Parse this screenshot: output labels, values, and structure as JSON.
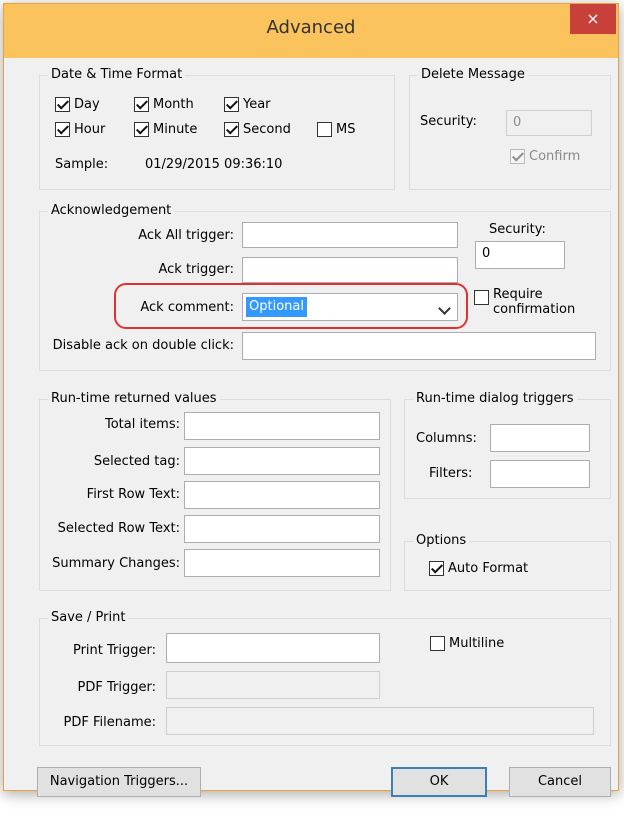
{
  "window": {
    "title": "Advanced",
    "close_glyph": "×"
  },
  "datetime": {
    "legend": "Date & Time Format",
    "day": "Day",
    "month": "Month",
    "year": "Year",
    "hour": "Hour",
    "minute": "Minute",
    "second": "Second",
    "ms": "MS",
    "sample_label": "Sample:",
    "sample_value": "01/29/2015 09:36:10"
  },
  "delete_message": {
    "legend": "Delete Message",
    "security_label": "Security:",
    "security_value": "0",
    "confirm": "Confirm"
  },
  "ack": {
    "legend": "Acknowledgement",
    "ack_all_label": "Ack All trigger:",
    "ack_trigger_label": "Ack trigger:",
    "ack_comment_label": "Ack comment:",
    "ack_comment_value": "Optional",
    "disable_dbl_label": "Disable ack on double click:",
    "security_label": "Security:",
    "security_value": "0",
    "require_line1": "Require",
    "require_line2": "confirmation"
  },
  "runtime_values": {
    "legend": "Run-time returned values",
    "total_items": "Total items:",
    "selected_tag": "Selected tag:",
    "first_row_text": "First Row Text:",
    "selected_row_text": "Selected Row Text:",
    "summary_changes": "Summary Changes:"
  },
  "dialog_triggers": {
    "legend": "Run-time dialog triggers",
    "columns": "Columns:",
    "filters": "Filters:"
  },
  "options": {
    "legend": "Options",
    "auto_format": "Auto Format"
  },
  "save_print": {
    "legend": "Save / Print",
    "print_trigger": "Print Trigger:",
    "pdf_trigger": "PDF Trigger:",
    "pdf_filename": "PDF Filename:",
    "multiline": "Multiline"
  },
  "buttons": {
    "navigation": "Navigation Triggers...",
    "ok": "OK",
    "cancel": "Cancel"
  },
  "colors": {
    "titlebar": "#fbc35d",
    "close": "#c7403a",
    "highlight": "#e0312f",
    "selection": "#3399ff"
  }
}
